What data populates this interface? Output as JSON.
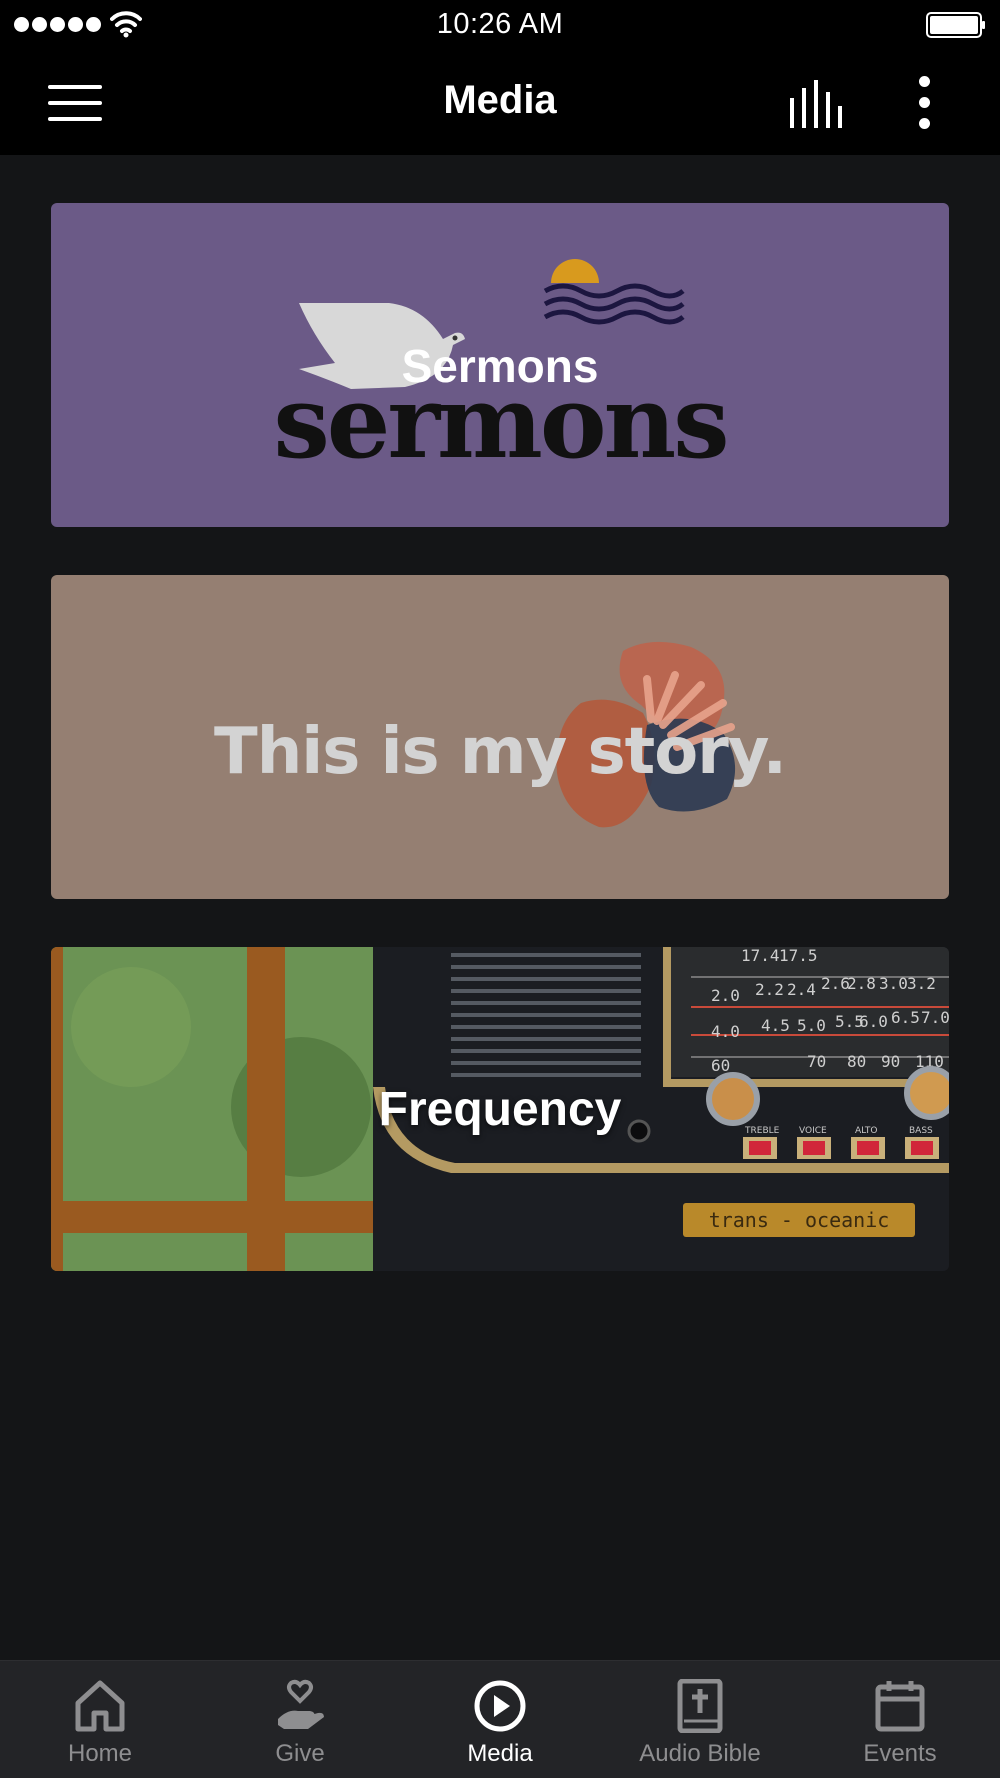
{
  "status_bar": {
    "time": "10:26 AM",
    "signal_icon": "signal-dots-icon",
    "wifi_icon": "wifi-icon",
    "battery_icon": "battery-icon"
  },
  "app_bar": {
    "title": "Media",
    "menu_icon": "hamburger-menu-icon",
    "audio_icon": "audio-bars-icon",
    "more_icon": "more-vertical-icon"
  },
  "cards": [
    {
      "label": "Sermons",
      "artwork_text": "sermons",
      "colors": {
        "background": "#6b5a87",
        "sun": "#d89a1e",
        "dove": "#d8d8d8",
        "waves": "#1c1640"
      }
    },
    {
      "label": "",
      "artwork_text": "This is my story.",
      "colors": {
        "background": "#957f72",
        "text": "#d3d3d3",
        "accent_orange": "#c0614a",
        "accent_blue": "#2b3a52"
      }
    },
    {
      "label": "Frequency",
      "artwork_text": "trans - oceanic",
      "dial_numbers": [
        "17.4",
        "17.5",
        "2.0",
        "2.2",
        "2.4",
        "2.6",
        "2.8",
        "3.0",
        "3.2",
        "4.0",
        "4.5",
        "5.0",
        "5.5",
        "6.0",
        "6.5",
        "7.0",
        "60",
        "70",
        "80",
        "90",
        "110"
      ],
      "knob_labels": [
        "TREBLE",
        "VOICE",
        "ALTO",
        "BASS"
      ],
      "colors": {
        "window_green": "#5f8a4c",
        "window_frame": "#9a5a20",
        "radio_body": "#1b1d22",
        "chrome": "#b49a62"
      }
    }
  ],
  "bottom_nav": [
    {
      "label": "Home",
      "icon": "home-icon",
      "active": false
    },
    {
      "label": "Give",
      "icon": "give-heart-hand-icon",
      "active": false
    },
    {
      "label": "Media",
      "icon": "play-circle-icon",
      "active": true
    },
    {
      "label": "Audio Bible",
      "icon": "bible-icon",
      "active": false
    },
    {
      "label": "Events",
      "icon": "calendar-icon",
      "active": false
    }
  ]
}
